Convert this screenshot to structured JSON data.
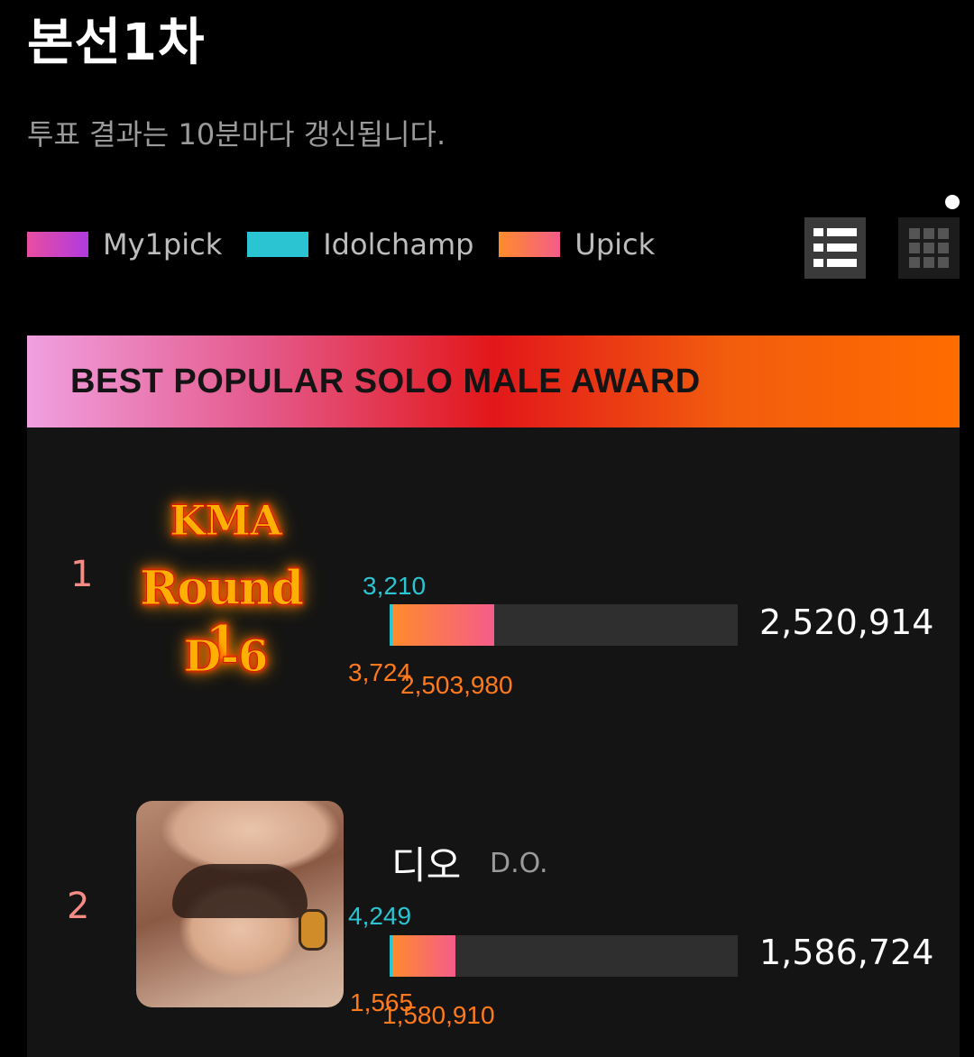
{
  "page": {
    "title": "본선1차",
    "subtitle": "투표 결과는 10분마다 갱신됩니다."
  },
  "legend": [
    {
      "label": "My1pick",
      "color_start": "#e94ea0",
      "color_end": "#b03ae0"
    },
    {
      "label": "Idolchamp",
      "color_start": "#2ac4d2",
      "color_end": "#2ac4d2"
    },
    {
      "label": "Upick",
      "color_start": "#ff8c2a",
      "color_end": "#f55c8a"
    }
  ],
  "view_toggle": {
    "list_icon": "list-view-icon",
    "grid_icon": "grid-view-icon",
    "active": "list"
  },
  "award": {
    "title": "BEST POPULAR SOLO MALE AWARD"
  },
  "overlay": {
    "line1": "KMA",
    "line2": "Round 1",
    "line3": "D-6"
  },
  "entries": [
    {
      "rank": "1",
      "idolchamp": "3,210",
      "my1pick": "3,724",
      "upick": "2,503,980",
      "total": "2,520,914",
      "fill_fraction": 0.3
    },
    {
      "rank": "2",
      "name_ko": "디오",
      "name_en": "D.O.",
      "idolchamp": "4,249",
      "my1pick": "1,565",
      "upick": "1,580,910",
      "total": "1,586,724",
      "fill_fraction": 0.19
    }
  ]
}
